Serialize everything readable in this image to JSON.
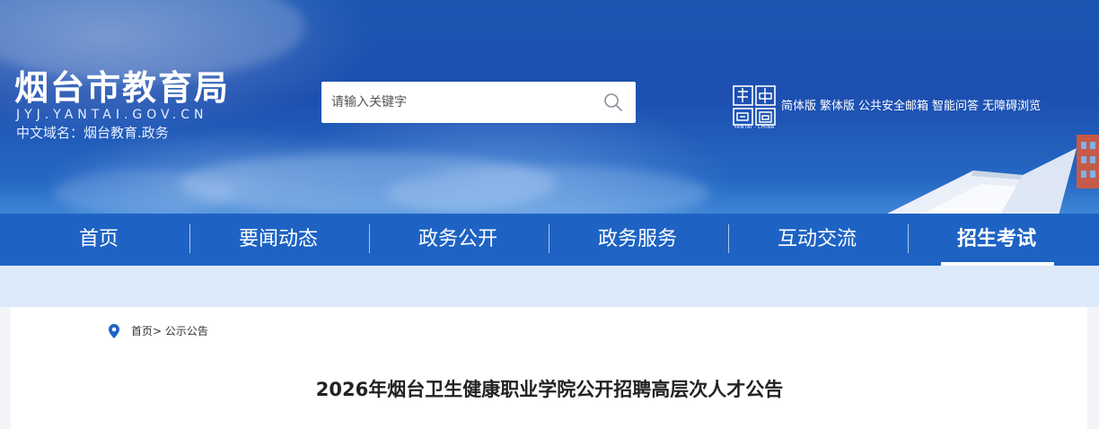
{
  "header": {
    "site_name": "烟台市教育局",
    "domain": "JYJ.YANTAI.GOV.CN",
    "cn_domain": "中文域名：烟台教育.政务",
    "emblem_caption": "YANTAI · CHINA"
  },
  "search": {
    "placeholder": "请输入关键字",
    "value": "",
    "icon": "search-icon"
  },
  "top_links": [
    "简体版",
    "繁体版",
    "公共安全邮箱",
    "智能问答",
    "无障碍浏览"
  ],
  "nav": {
    "items": [
      "首页",
      "要闻动态",
      "政务公开",
      "政务服务",
      "互动交流",
      "招生考试"
    ],
    "active": "招生考试"
  },
  "breadcrumb": {
    "icon": "location-pin-icon",
    "home": "首页>",
    "current": "公示公告"
  },
  "article": {
    "title": "2026年烟台卫生健康职业学院公开招聘高层次人才公告"
  },
  "colors": {
    "banner_blue": "#1d4fb0",
    "nav_blue": "#1e63c4",
    "strip_bg": "#dce9f8",
    "pin_blue": "#1e63c4"
  }
}
